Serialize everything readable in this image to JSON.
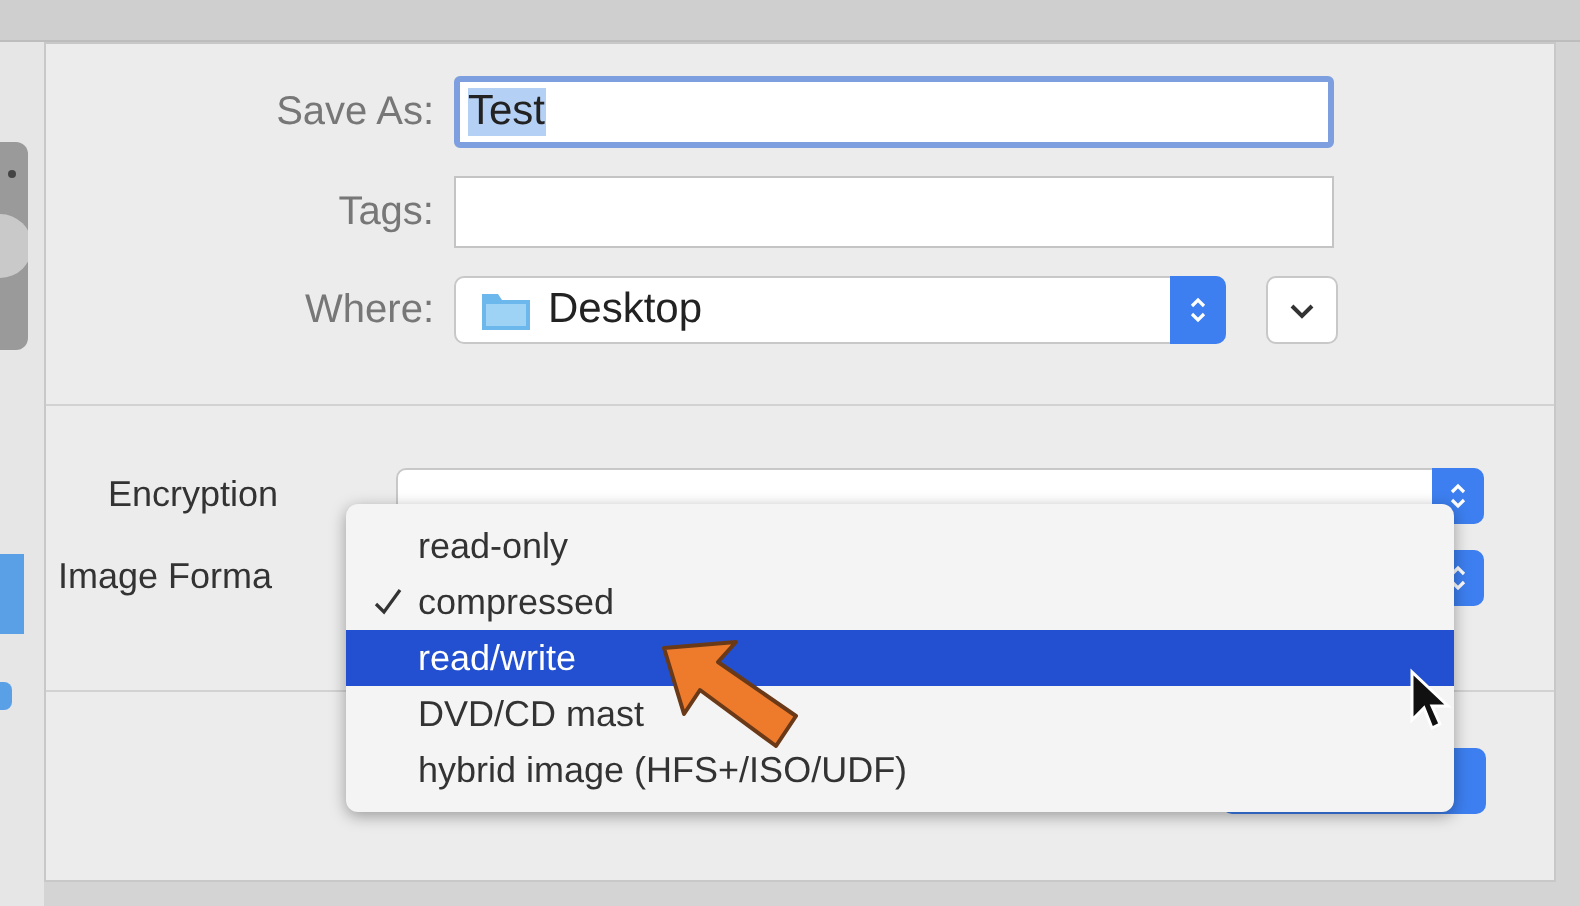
{
  "dialog": {
    "fields": [
      {
        "label": "Save As:",
        "value": "Test",
        "focused": true
      },
      {
        "label": "Tags:",
        "focused": false
      }
    ],
    "where": {
      "label": "Where:",
      "value": "Desktop"
    },
    "options": [
      {
        "label": "Encryption"
      },
      {
        "label": "Image Forma"
      }
    ],
    "menu": {
      "items": [
        {
          "label": "read-only",
          "checked": false,
          "selected": false
        },
        {
          "label": "compressed",
          "checked": true,
          "selected": false
        },
        {
          "label": "read/write",
          "checked": false,
          "selected": true
        },
        {
          "label": "DVD/CD mast",
          "checked": false,
          "selected": false
        },
        {
          "label": "hybrid image (HFS+/ISO/UDF)",
          "checked": false,
          "selected": false
        }
      ]
    }
  }
}
